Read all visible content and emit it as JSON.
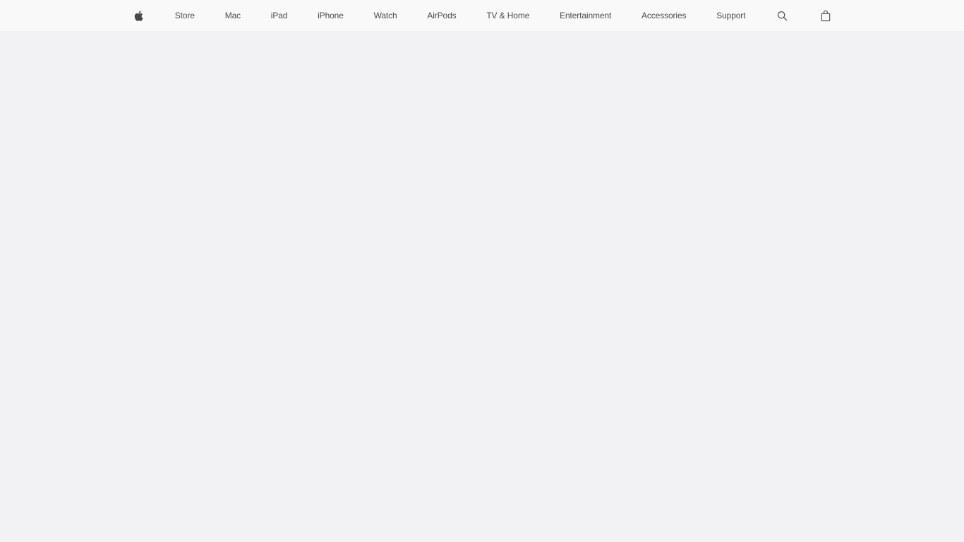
{
  "page": {
    "title": "Apple",
    "background_color": "#f2f2f4",
    "content_text": ""
  },
  "global_nav": {
    "aria_label": "Global",
    "background_color": "#f9f9fa",
    "text_color": "#1d1d1f",
    "items": [
      {
        "id": "apple",
        "label": "Apple",
        "icon": "apple-logo-icon",
        "type": "icon"
      },
      {
        "id": "store",
        "label": "Store",
        "icon": null,
        "type": "text"
      },
      {
        "id": "mac",
        "label": "Mac",
        "icon": null,
        "type": "text"
      },
      {
        "id": "ipad",
        "label": "iPad",
        "icon": null,
        "type": "text"
      },
      {
        "id": "iphone",
        "label": "iPhone",
        "icon": null,
        "type": "text"
      },
      {
        "id": "watch",
        "label": "Watch",
        "icon": null,
        "type": "text"
      },
      {
        "id": "airpods",
        "label": "AirPods",
        "icon": null,
        "type": "text"
      },
      {
        "id": "tv-home",
        "label": "TV & Home",
        "icon": null,
        "type": "text"
      },
      {
        "id": "entertainment",
        "label": "Entertainment",
        "icon": null,
        "type": "text"
      },
      {
        "id": "accessories",
        "label": "Accessories",
        "icon": null,
        "type": "text"
      },
      {
        "id": "support",
        "label": "Support",
        "icon": null,
        "type": "text"
      },
      {
        "id": "search",
        "label": "Search apple.com",
        "icon": "search-icon",
        "type": "icon"
      },
      {
        "id": "bag",
        "label": "Shopping Bag",
        "icon": "bag-icon",
        "type": "icon"
      }
    ]
  }
}
